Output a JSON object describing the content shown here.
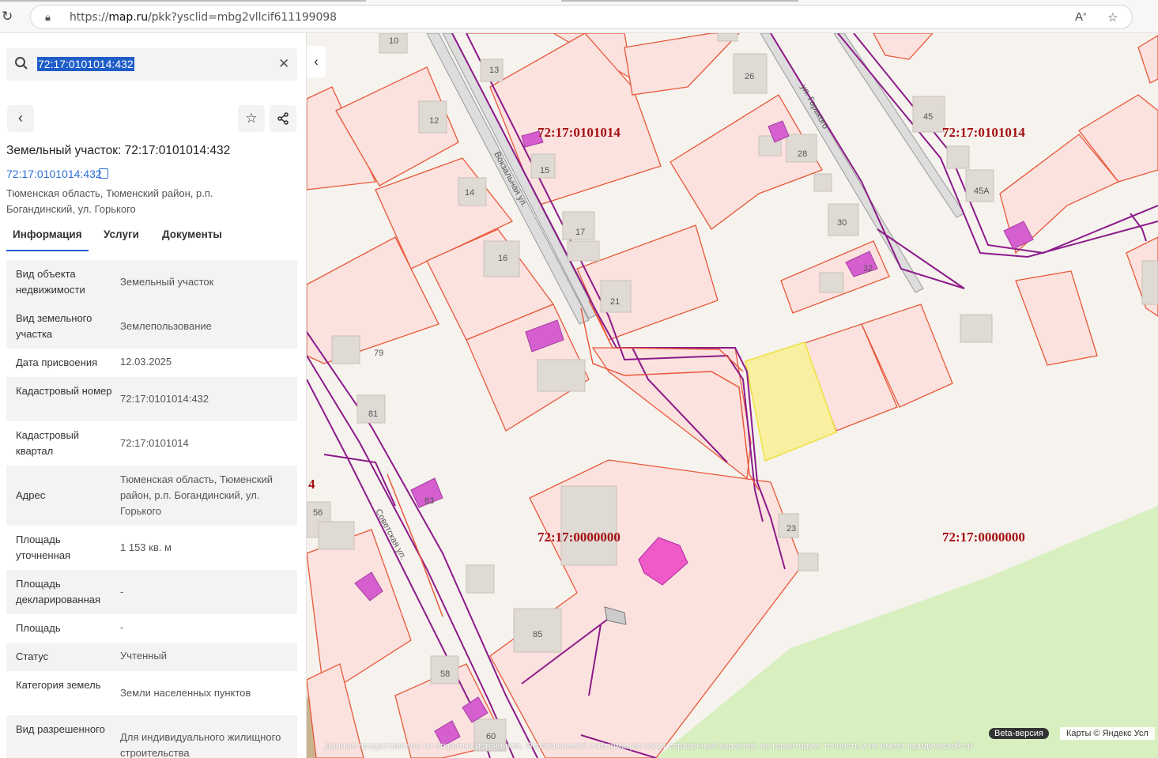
{
  "browser": {
    "url_prefix": "https://",
    "url_host": "map.ru",
    "url_path": "/pkk?ysclid=mbg2vllcif611199098"
  },
  "search": {
    "value": "72:17:0101014:432"
  },
  "card": {
    "title": "Земельный участок: 72:17:0101014:432",
    "number_link": "72:17:0101014:432",
    "address_line1": "Тюменская область, Тюменский район, р.п.",
    "address_line2": "Богандинский, ул. Горького"
  },
  "tabs": [
    {
      "label": "Информация"
    },
    {
      "label": "Услуги"
    },
    {
      "label": "Документы"
    }
  ],
  "properties": [
    {
      "label": "Вид объекта недвижимости",
      "value": "Земельный участок"
    },
    {
      "label": "Вид земельного участка",
      "value": "Землепользование"
    },
    {
      "label": "Дата присвоения",
      "value": "12.03.2025"
    },
    {
      "label": "Кадастровый номер",
      "value": "72:17:0101014:432"
    },
    {
      "label": "Кадастровый квартал",
      "value": "72:17:0101014"
    },
    {
      "label": "Адрес",
      "value": "Тюменская область, Тюменский район, р.п. Богандинский, ул. Горького"
    },
    {
      "label": "Площадь уточненная",
      "value": "1 153 кв. м"
    },
    {
      "label": "Площадь декларированная",
      "value": "-"
    },
    {
      "label": "Площадь",
      "value": "-"
    },
    {
      "label": "Статус",
      "value": "Учтенный"
    },
    {
      "label": "Категория земель",
      "value": "Земли населенных пунктов"
    },
    {
      "label": "Вид разрешенного",
      "value": "Для индивидуального жилищного строительства"
    }
  ],
  "map": {
    "quarter_labels": [
      "72:17:0101014",
      "72:17:0101014",
      "72:17:0000000",
      "72:17:0000000",
      "4"
    ],
    "street_labels": [
      "ул. Горького",
      "Вокзальная ул.",
      "Советская ул."
    ],
    "house_numbers": [
      "10",
      "13",
      "12",
      "15",
      "14",
      "17",
      "16",
      "21",
      "26",
      "28",
      "30",
      "32",
      "45",
      "45А",
      "79",
      "81",
      "83",
      "56",
      "85",
      "58",
      "60",
      "23"
    ],
    "beta_label": "Beta-версия",
    "copyright": "Карты © Яндекс   Усл",
    "disclaimer": "Данные предоставлены из открытых источников. Отображаемая информация носит справочный характер, не гарантирует точность и не имеет юридической си",
    "colors": {
      "parcel_fill": "#fbe2de",
      "parcel_stroke": "#e8583a",
      "selected_fill": "#f8f0a0",
      "selected_stroke": "#f0e040",
      "building": "#d65fd0",
      "utility": "#8c1a8a",
      "green": "#d8efc0",
      "label_red": "#a40f12"
    }
  }
}
